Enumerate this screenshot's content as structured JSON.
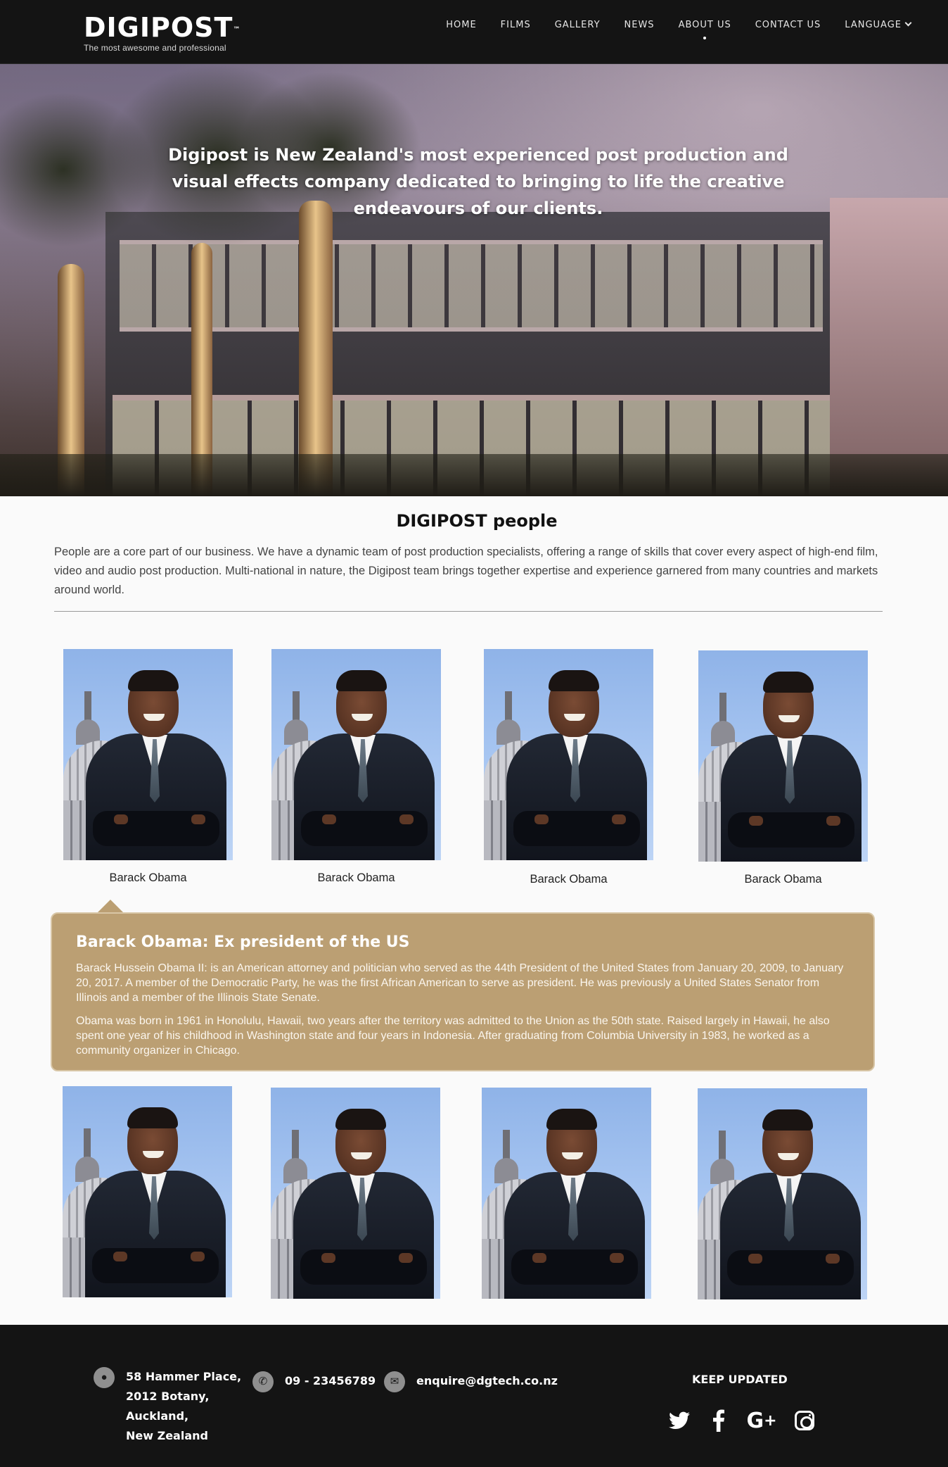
{
  "brand": {
    "name": "DIGIPOST",
    "tagline": "The most awesome and professional"
  },
  "nav": {
    "items": [
      {
        "label": "HOME"
      },
      {
        "label": "FILMS"
      },
      {
        "label": "GALLERY"
      },
      {
        "label": "NEWS"
      },
      {
        "label": "ABOUT US",
        "active": true
      },
      {
        "label": "CONTACT US"
      },
      {
        "label": "LANGUAGE",
        "dropdown": true
      }
    ]
  },
  "hero": {
    "headline": "Digipost is New Zealand's most experienced post production and visual effects company dedicated to bringing to life the creative endeavours of our clients."
  },
  "people": {
    "title": "DIGIPOST people",
    "intro": "People are a core part of our business.  We have a dynamic team of post production specialists, offering a range of skills that cover every aspect of high-end film, video and audio post production.  Multi-national in nature, the Digipost team brings together expertise and experience garnered from many countries and  markets around world.",
    "row1": [
      {
        "name": "Barack Obama"
      },
      {
        "name": "Barack Obama"
      },
      {
        "name": "Barack Obama"
      },
      {
        "name": "Barack Obama"
      }
    ],
    "row2_count_visible": 4
  },
  "bio": {
    "title": "Barack Obama: Ex president of the US",
    "paragraphs": [
      "Barack Hussein Obama II: is an American attorney and politician who served as the 44th President of the United States from January 20, 2009, to January 20, 2017. A member of the Democratic Party, he was the first African American to serve as president. He was previously a United States Senator from Illinois and a member of the Illinois State Senate.",
      "Obama was born in 1961 in Honolulu, Hawaii, two years after the territory was admitted to the Union as the 50th state. Raised largely in Hawaii, he also spent one year of his childhood in Washington state and four years in Indonesia. After graduating from Columbia University in 1983, he worked as a community organizer in Chicago."
    ]
  },
  "footer": {
    "address_lines": [
      "58 Hammer Place,",
      "2012 Botany,",
      "Auckland,",
      "New Zealand"
    ],
    "phone": "09 - 23456789",
    "email": "enquire@dgtech.co.nz",
    "keep_updated": "KEEP UPDATED",
    "social_icons": [
      "twitter-icon",
      "facebook-icon",
      "google-plus-icon",
      "instagram-icon"
    ]
  },
  "colors": {
    "nav_bg": "#141414",
    "bio_bg": "#bb9f73",
    "footer_bg": "#141414",
    "page_bg": "#fafafa"
  }
}
